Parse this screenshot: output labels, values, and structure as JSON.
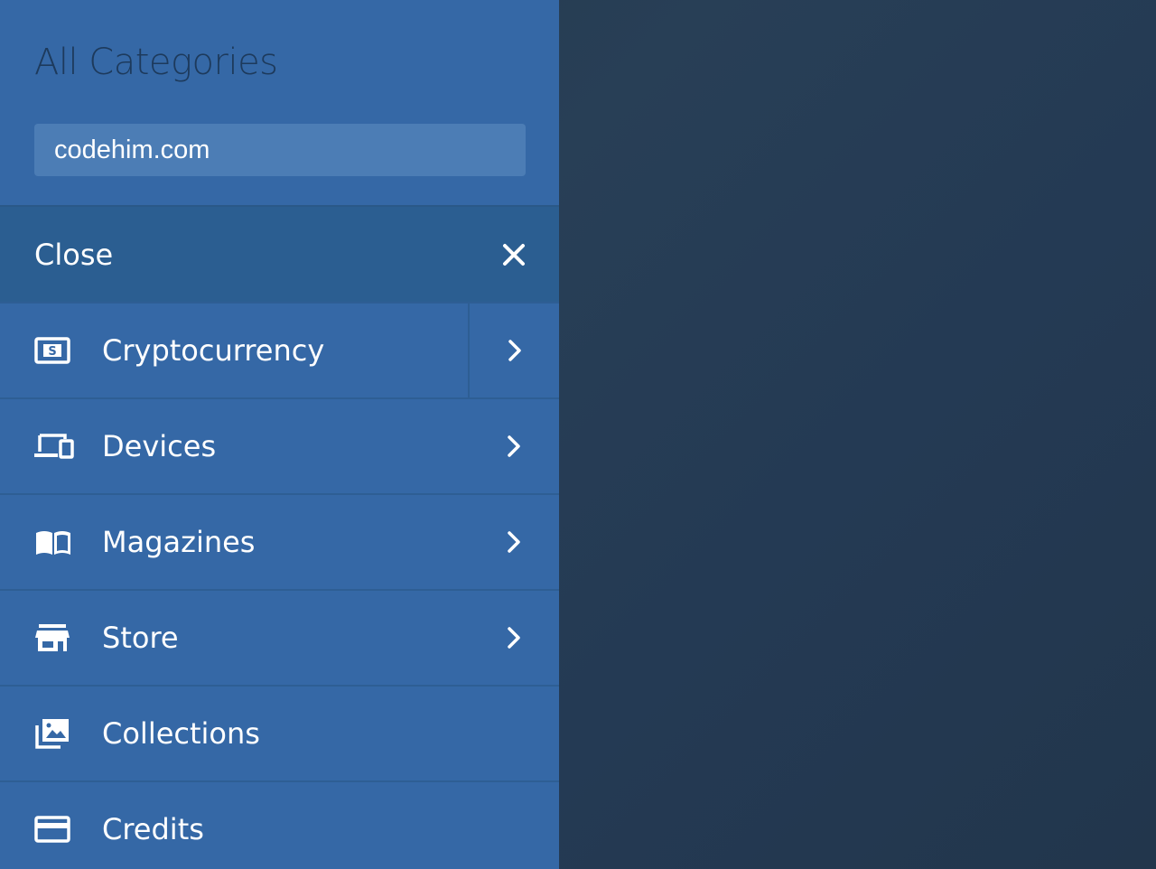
{
  "sidebar": {
    "title": "All Categories",
    "search": {
      "value": "codehim.com",
      "placeholder": ""
    },
    "close_label": "Close",
    "items": [
      {
        "label": "Cryptocurrency",
        "icon": "money-icon",
        "has_submenu": true
      },
      {
        "label": "Devices",
        "icon": "devices-icon",
        "has_submenu": true
      },
      {
        "label": "Magazines",
        "icon": "book-icon",
        "has_submenu": true
      },
      {
        "label": "Store",
        "icon": "store-icon",
        "has_submenu": true
      },
      {
        "label": "Collections",
        "icon": "collections-icon",
        "has_submenu": false
      },
      {
        "label": "Credits",
        "icon": "credit-card-icon",
        "has_submenu": false
      }
    ]
  },
  "colors": {
    "sidebar_bg": "#3568a6",
    "close_row_bg": "#2b5e91",
    "search_bg": "#4c7db5",
    "title_color": "#1d3a5c",
    "backdrop": "#243a52"
  }
}
